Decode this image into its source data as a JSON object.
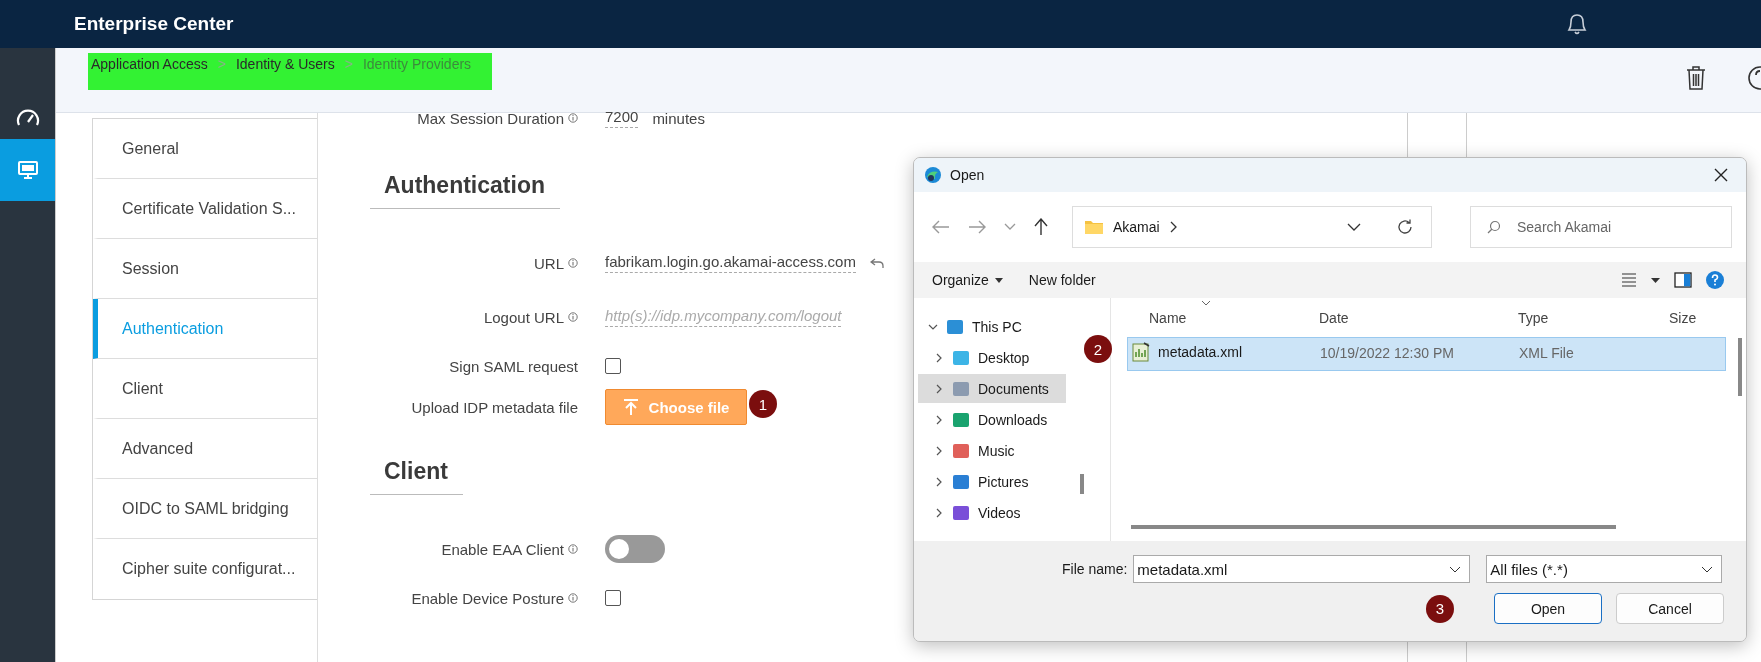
{
  "header": {
    "title": "Enterprise Center"
  },
  "rail": [
    {
      "kind": "gauge",
      "selected": false
    },
    {
      "kind": "monitor",
      "selected": true
    }
  ],
  "breadcrumb": [
    {
      "label": "Application Access",
      "current": false
    },
    {
      "separator": ">",
      "label": "Identity & Users",
      "current": false
    },
    {
      "separator": ">",
      "label": "Identity Providers",
      "current": true
    }
  ],
  "side_nav": [
    {
      "label": "General",
      "selected": false
    },
    {
      "label": "Certificate Validation S...",
      "selected": false
    },
    {
      "label": "Session",
      "selected": false
    },
    {
      "label": "Authentication",
      "selected": true
    },
    {
      "label": "Client",
      "selected": false
    },
    {
      "label": "Advanced",
      "selected": false
    },
    {
      "label": "OIDC to SAML bridging",
      "selected": false
    },
    {
      "label": "Cipher suite configurat...",
      "selected": false
    }
  ],
  "form": [
    {
      "kind": "field",
      "label": "Max Session Duration",
      "info": true,
      "value": "7200",
      "unit": "minutes"
    },
    {
      "kind": "heading",
      "label": "Authentication"
    },
    {
      "kind": "field",
      "label": "URL",
      "info": true,
      "value": "fabrikam.login.go.akamai-access.com",
      "resettable": true
    },
    {
      "kind": "field",
      "label": "Logout URL",
      "info": true,
      "placeholder": "http(s)://idp.mycompany.com/logout"
    },
    {
      "kind": "checkbox",
      "label": "Sign SAML request",
      "info": false,
      "checked": false
    },
    {
      "kind": "upload",
      "label": "Upload IDP metadata file",
      "info": false,
      "button": "Choose file",
      "step": "1"
    },
    {
      "kind": "heading",
      "label": "Client"
    },
    {
      "kind": "toggle",
      "label": "Enable EAA Client",
      "info": true,
      "on": false
    },
    {
      "kind": "checkbox",
      "label": "Enable Device Posture",
      "info": true,
      "checked": false
    }
  ],
  "dialog": {
    "title": "Open",
    "path": "Akamai",
    "search_placeholder": "Search Akamai",
    "toolbar": [
      "Organize",
      "New folder"
    ],
    "tree": [
      {
        "label": "This PC",
        "kind": "pc",
        "selected": false,
        "expanded": true,
        "children": [
          {
            "label": "Desktop",
            "kind": "desktop",
            "selected": false,
            "expanded": false
          },
          {
            "label": "Documents",
            "kind": "documents",
            "selected": true,
            "expanded": false
          },
          {
            "label": "Downloads",
            "kind": "downloads",
            "selected": false,
            "expanded": false
          },
          {
            "label": "Music",
            "kind": "music",
            "selected": false,
            "expanded": false
          },
          {
            "label": "Pictures",
            "kind": "pictures",
            "selected": false,
            "expanded": false
          },
          {
            "label": "Videos",
            "kind": "videos",
            "selected": false,
            "expanded": false
          }
        ]
      }
    ],
    "columns": [
      "Name",
      "Date",
      "Type",
      "Size"
    ],
    "files": [
      {
        "name": "metadata.xml",
        "date": "10/19/2022 12:30 PM",
        "type": "XML File",
        "selected": true,
        "step": "2"
      }
    ],
    "file_name_label": "File name:",
    "file_name": "metadata.xml",
    "filter": "All files (*.*)",
    "buttons": [
      {
        "label": "Open",
        "primary": true,
        "step": "3"
      },
      {
        "label": "Cancel",
        "primary": false
      }
    ]
  }
}
